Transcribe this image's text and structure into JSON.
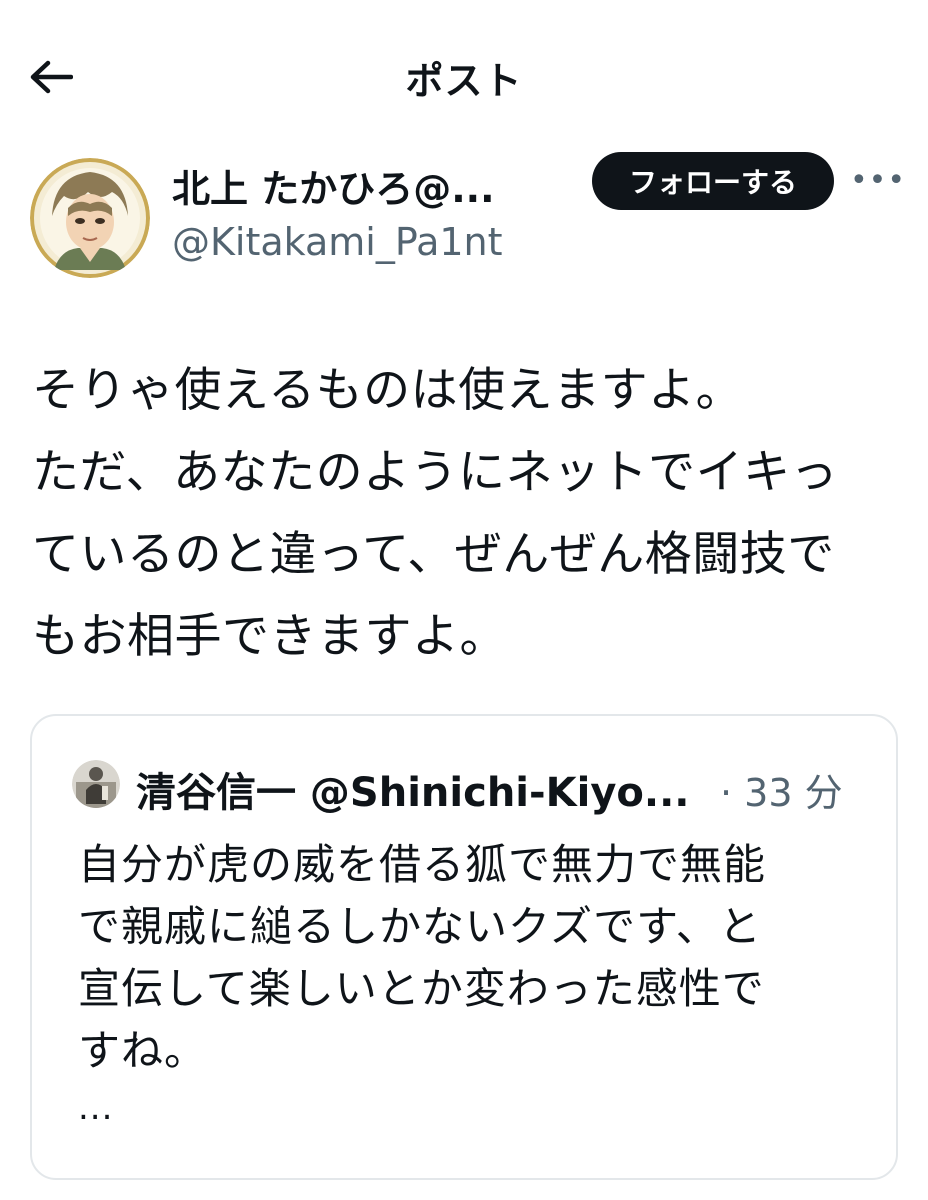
{
  "header": {
    "title": "ポスト",
    "back_icon": "arrow-left-icon"
  },
  "author": {
    "name": "北上 たかひろ@...",
    "handle": "@Kitakami_Pa1nt",
    "avatar_icon": "anime-avatar",
    "follow_label": "フォローする",
    "more_label": "•••"
  },
  "post": {
    "text": "そりゃ使えるものは使えますよ。\nただ、あなたのようにネットでイキっ\nているのと違って、ぜんぜん格闘技で\nもお相手できますよ。"
  },
  "quote": {
    "name": "清谷信一 @Shinichi-Kiyo...",
    "time": "· 33 分",
    "text": "自分が虎の威を借る狐で無力で無能\nで親戚に縋るしかないクズです、と\n宣伝して楽しいとか変わった感性で\nすね。",
    "ellipsis": "...",
    "avatar_icon": "statue-avatar"
  },
  "colors": {
    "text": "#0f1419",
    "secondary": "#536471",
    "border": "#e3e7ea",
    "follow_bg": "#0f1419"
  }
}
